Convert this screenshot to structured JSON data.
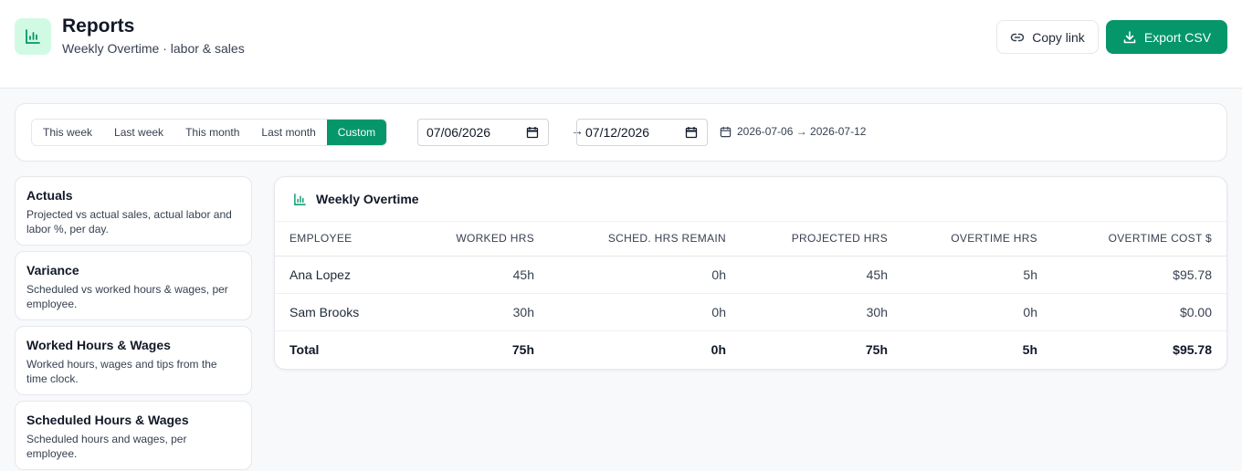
{
  "header": {
    "title": "Reports",
    "subtitle": "Weekly Overtime · labor & sales",
    "copy_label": "Copy link",
    "export_label": "Export CSV"
  },
  "filters": {
    "ranges": [
      "This week",
      "Last week",
      "This month",
      "Last month",
      "Custom"
    ],
    "active_range": "Custom",
    "start_date": "07/06/2026",
    "end_date": "07/12/2026",
    "arrow": "→",
    "summary": "2026-07-06 → 2026-07-12"
  },
  "sidebar": {
    "items": [
      {
        "name": "Actuals",
        "desc": "Projected vs actual sales, actual labor and labor %, per day."
      },
      {
        "name": "Variance",
        "desc": "Scheduled vs worked hours & wages, per employee."
      },
      {
        "name": "Worked Hours & Wages",
        "desc": "Worked hours, wages and tips from the time clock."
      },
      {
        "name": "Scheduled Hours & Wages",
        "desc": "Scheduled hours and wages, per employee."
      }
    ]
  },
  "report": {
    "title": "Weekly Overtime",
    "columns": [
      "EMPLOYEE",
      "WORKED HRS",
      "SCHED. HRS REMAIN",
      "PROJECTED HRS",
      "OVERTIME HRS",
      "OVERTIME COST $"
    ],
    "rows": [
      [
        "Ana Lopez",
        "45h",
        "0h",
        "45h",
        "5h",
        "$95.78"
      ],
      [
        "Sam Brooks",
        "30h",
        "0h",
        "30h",
        "0h",
        "$0.00"
      ]
    ],
    "total": [
      "Total",
      "75h",
      "0h",
      "75h",
      "5h",
      "$95.78"
    ]
  },
  "colors": {
    "accent": "#059669",
    "accent_light": "#d1fae5"
  },
  "icons": {
    "app": "bar-chart-icon",
    "copy": "link-icon",
    "export": "download-icon",
    "calendar": "calendar-icon"
  }
}
